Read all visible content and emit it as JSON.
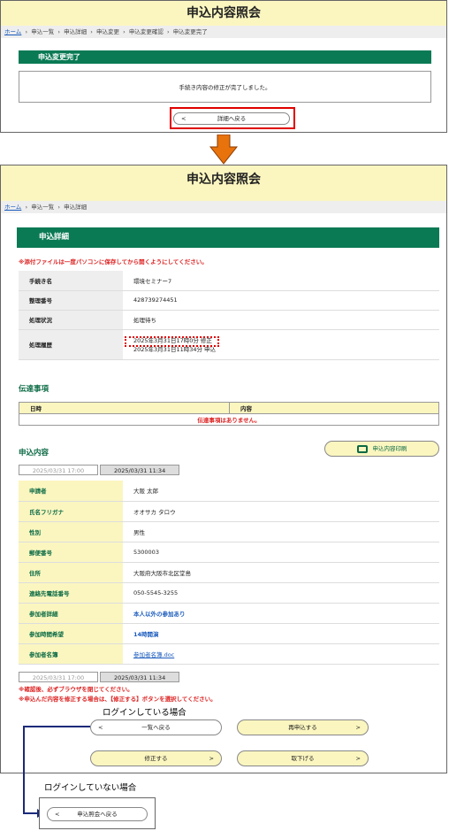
{
  "top": {
    "title": "申込内容照会",
    "breadcrumb": [
      "ホーム",
      "申込一覧",
      "申込詳細",
      "申込変更",
      "申込変更確認",
      "申込変更完了"
    ],
    "section": "申込変更完了",
    "message": "手続き内容の修正が完了しました。",
    "back_button": "詳細へ戻る"
  },
  "bottom": {
    "title": "申込内容照会",
    "breadcrumb": [
      "ホーム",
      "申込一覧",
      "申込詳細"
    ],
    "section": "申込詳細",
    "attach_warning": "※添付ファイルは一度パソコンに保存してから開くようにしてください。",
    "detail_rows": [
      {
        "label": "手続き名",
        "value": "環境セミナー7"
      },
      {
        "label": "整理番号",
        "value": "428739274451"
      },
      {
        "label": "処理状況",
        "value": "処理待ち"
      }
    ],
    "history_label": "処理履歴",
    "history": [
      "2025年3月31日17時0分 修正",
      "2025年3月31日11時34分 申込"
    ],
    "notice": {
      "title": "伝達事項",
      "col_date": "日時",
      "col_content": "内容",
      "empty": "伝達事項はありません。"
    },
    "content": {
      "title": "申込内容",
      "print_button": "申込内容印刷",
      "tabs": [
        "2025/03/31 17:00",
        "2025/03/31 11:34"
      ],
      "rows": [
        {
          "label": "申請者",
          "value": "大阪 太郎"
        },
        {
          "label": "氏名フリガナ",
          "value": "オオサカ タロウ"
        },
        {
          "label": "性別",
          "value": "男性"
        },
        {
          "label": "郵便番号",
          "value": "5300003"
        },
        {
          "label": "住所",
          "value": "大阪府大阪市北区堂島"
        },
        {
          "label": "連絡先電話番号",
          "value": "050-5545-3255"
        },
        {
          "label": "参加者詳細",
          "value": "本人以外の参加あり"
        },
        {
          "label": "参加時間希望",
          "value": "14時開演"
        },
        {
          "label": "参加者名簿",
          "value": "参加者名簿.doc"
        }
      ]
    },
    "warn1": "※確認後、必ずブラウザを閉じてください。",
    "warn2": "※申込んだ内容を修正する場合は、【修正する】ボタンを選択してください。",
    "logged_in_caption": "ログインしている場合",
    "btn_list_back": "一覧へ戻る",
    "btn_reapply": "再申込する",
    "btn_modify": "修正する",
    "btn_cancel": "取下げる"
  },
  "logged_out_caption": "ログインしていない場合",
  "btn_inquiry_back": "申込照会へ戻る",
  "colors": {
    "header_bg": "#fbf6c0",
    "section_bar": "#0a7a54",
    "highlight": "#e00000",
    "arrow": "#e8720c"
  }
}
